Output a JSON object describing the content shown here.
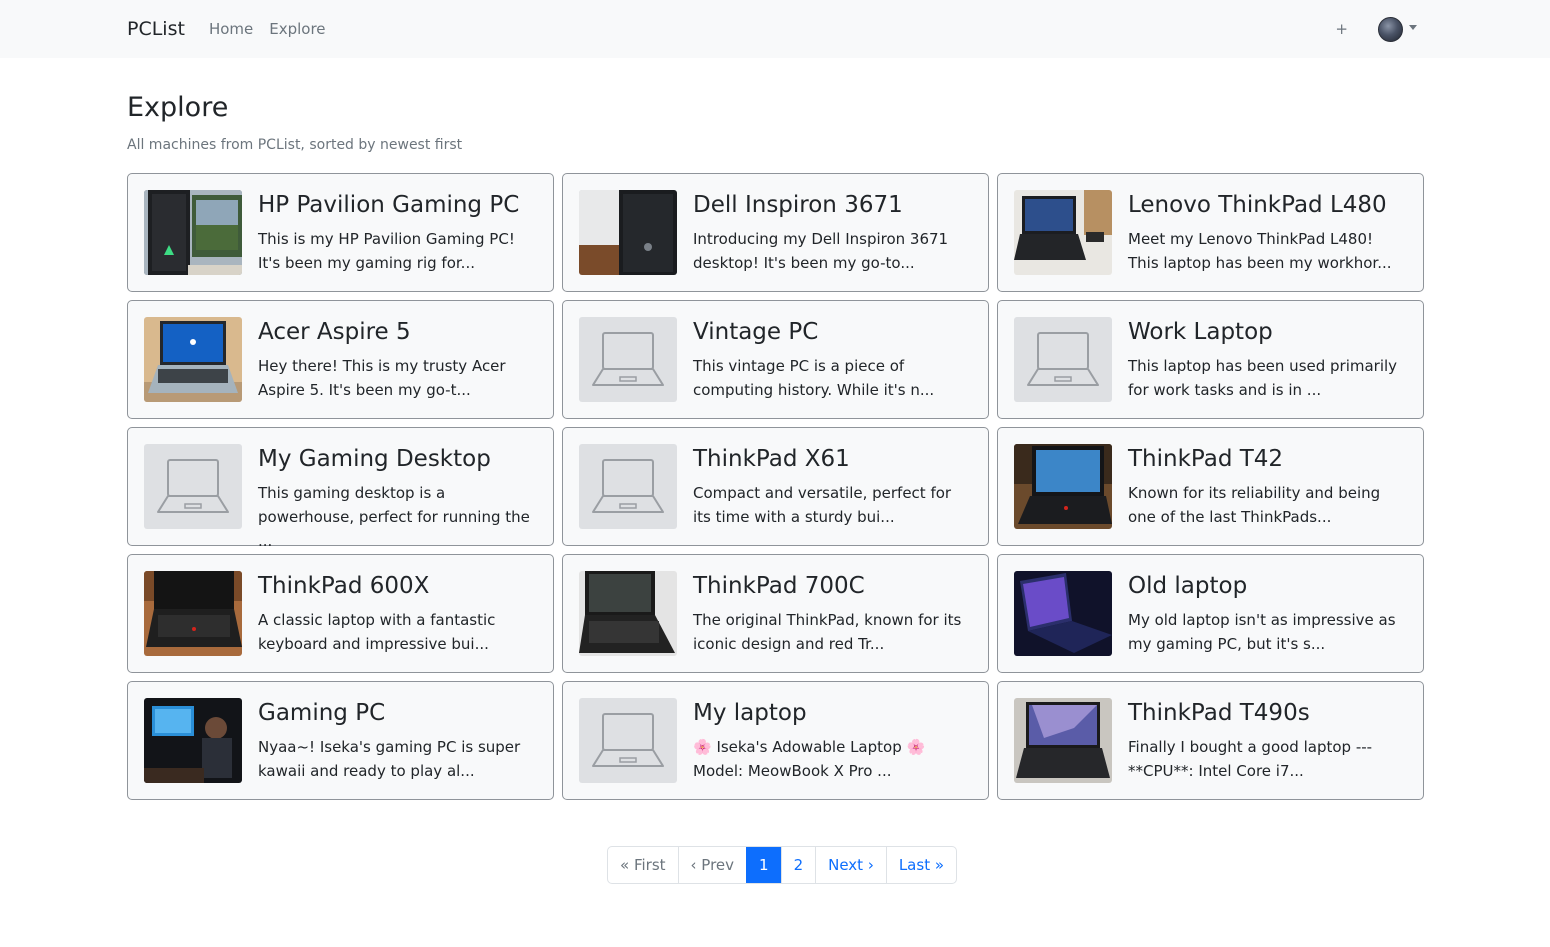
{
  "navbar": {
    "brand": "PCList",
    "links": [
      "Home",
      "Explore"
    ],
    "add_label": "+"
  },
  "page": {
    "title": "Explore",
    "subtitle": "All machines from PCList, sorted by newest first"
  },
  "machines": [
    {
      "title": "HP Pavilion Gaming PC",
      "desc": "This is my HP Pavilion Gaming PC! It's been my gaming rig for...",
      "thumb": "photo"
    },
    {
      "title": "Dell Inspiron 3671",
      "desc": "Introducing my Dell Inspiron 3671 desktop! It's been my go-to...",
      "thumb": "photo"
    },
    {
      "title": "Lenovo ThinkPad L480",
      "desc": "Meet my Lenovo ThinkPad L480! This laptop has been my workhor...",
      "thumb": "photo"
    },
    {
      "title": "Acer Aspire 5",
      "desc": "Hey there! This is my trusty Acer Aspire 5. It's been my go-t...",
      "thumb": "photo"
    },
    {
      "title": "Vintage PC",
      "desc": "This vintage PC is a piece of computing history. While it's n...",
      "thumb": "placeholder"
    },
    {
      "title": "Work Laptop",
      "desc": "This laptop has been used primarily for work tasks and is in ...",
      "thumb": "placeholder"
    },
    {
      "title": "My Gaming Desktop",
      "desc": "This gaming desktop is a powerhouse, perfect for running the ...",
      "thumb": "placeholder"
    },
    {
      "title": "ThinkPad X61",
      "desc": "Compact and versatile, perfect for its time with a sturdy bui...",
      "thumb": "placeholder"
    },
    {
      "title": "ThinkPad T42",
      "desc": "Known for its reliability and being one of the last ThinkPads...",
      "thumb": "photo"
    },
    {
      "title": "ThinkPad 600X",
      "desc": "A classic laptop with a fantastic keyboard and impressive bui...",
      "thumb": "photo"
    },
    {
      "title": "ThinkPad 700C",
      "desc": "The original ThinkPad, known for its iconic design and red Tr...",
      "thumb": "photo"
    },
    {
      "title": "Old laptop",
      "desc": "My old laptop isn't as impressive as my gaming PC, but it's s...",
      "thumb": "photo"
    },
    {
      "title": "Gaming PC",
      "desc": "Nyaa~! Iseka's gaming PC is super kawaii and ready to play al...",
      "thumb": "photo"
    },
    {
      "title": "My laptop",
      "desc": "🌸 Iseka's Adowable Laptop 🌸 Model: MeowBook X Pro ...",
      "thumb": "placeholder"
    },
    {
      "title": "ThinkPad T490s",
      "desc": "Finally I bought a good laptop --- **CPU**: Intel Core i7...",
      "thumb": "photo"
    }
  ],
  "pagination": {
    "first": "« First",
    "prev": "‹ Prev",
    "pages": [
      "1",
      "2"
    ],
    "current": "1",
    "next": "Next ›",
    "last": "Last »"
  },
  "colors": {
    "accent": "#0d6efd",
    "navbar_bg": "#f8f9fa",
    "card_bg": "#f8f9fa",
    "muted": "#6c757d"
  }
}
